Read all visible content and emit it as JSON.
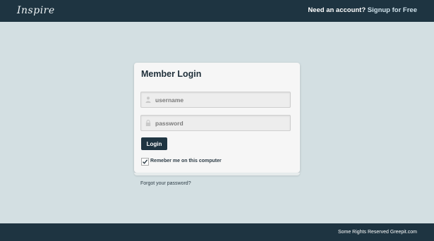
{
  "header": {
    "logo": "Inspire",
    "signup_lead": "Need an account?",
    "signup_link": "Signup for Free"
  },
  "login": {
    "title": "Member Login",
    "username_placeholder": "username",
    "password_placeholder": "password",
    "button_label": "Login",
    "remember_label": "Remeber me on this computer",
    "remember_checked": true,
    "forgot_link": "Forgot your password?"
  },
  "footer": {
    "text": "Some Rights Reserved Greepit.com"
  },
  "icons": {
    "username": "user-icon",
    "password": "lock-icon",
    "remember": "checkmark-icon"
  },
  "colors": {
    "background": "#d3dfe2",
    "bar": "#1e3441",
    "button": "#1f3542"
  }
}
